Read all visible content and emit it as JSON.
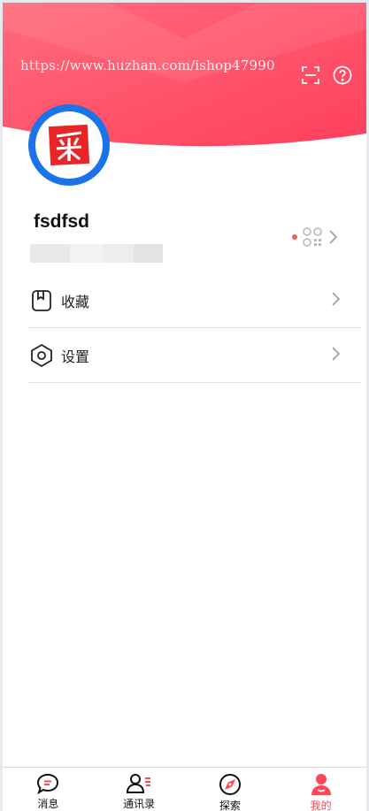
{
  "watermark": "https://www.huzhan.com/ishop47990",
  "colors": {
    "brand_red": "#ff4d65",
    "avatar_ring": "#1a73e8",
    "active_tab": "#ff4757",
    "notice_dot": "#f2604f"
  },
  "header": {
    "scan_icon": "scan-icon",
    "help_icon": "help-circle-icon"
  },
  "profile": {
    "avatar_icon": "red-seal-logo",
    "username": "fsdfsd",
    "qr_icon": "qr-code-icon"
  },
  "menu": [
    {
      "id": "favorites",
      "icon": "bookmark-icon",
      "label": "收藏"
    },
    {
      "id": "settings",
      "icon": "hexagon-settings-icon",
      "label": "设置"
    }
  ],
  "tabbar": [
    {
      "id": "messages",
      "icon": "chat-bubble-icon",
      "label": "消息",
      "active": false
    },
    {
      "id": "contacts",
      "icon": "contacts-icon",
      "label": "通讯录",
      "active": false
    },
    {
      "id": "explore",
      "icon": "compass-icon",
      "label": "探索",
      "active": false
    },
    {
      "id": "me",
      "icon": "person-icon",
      "label": "我的",
      "active": true
    }
  ]
}
